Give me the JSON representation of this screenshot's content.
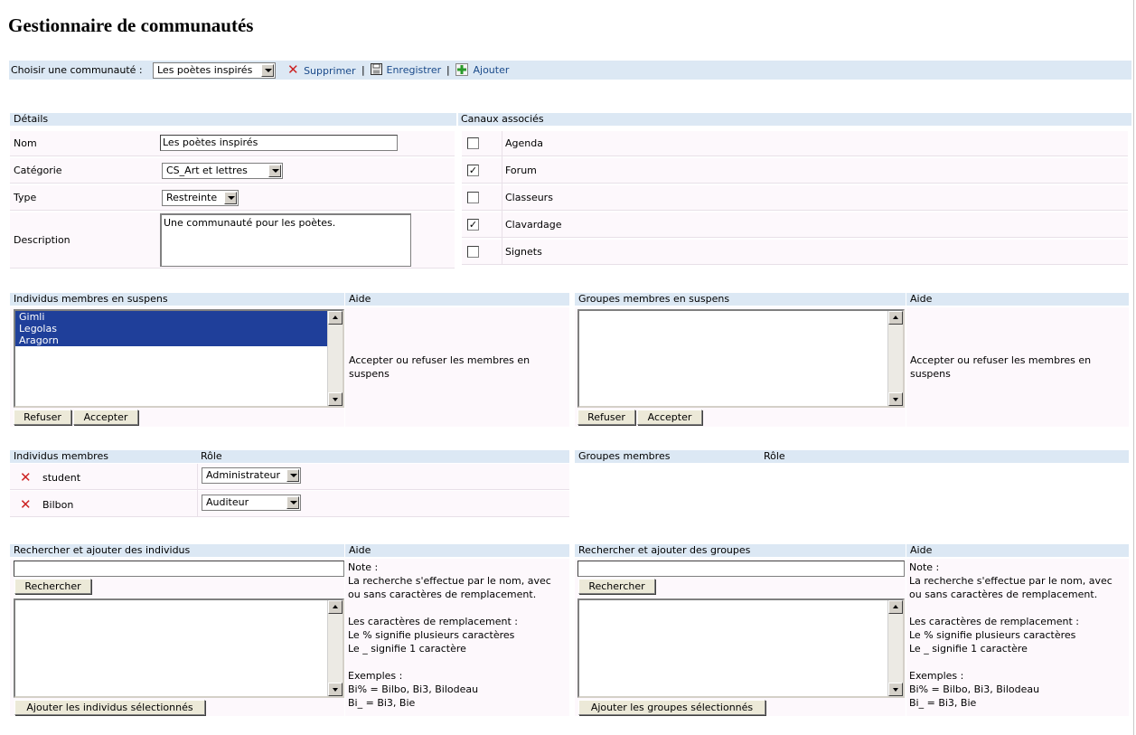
{
  "title": "Gestionnaire de communautés",
  "toolbar": {
    "choose_label": "Choisir une communauté :",
    "selected_community": "Les poètes inspirés",
    "delete_label": "Supprimer",
    "save_label": "Enregistrer",
    "add_label": "Ajouter",
    "separator": "|"
  },
  "details": {
    "header": "Détails",
    "name_label": "Nom",
    "name_value": "Les poètes inspirés",
    "category_label": "Catégorie",
    "category_value": "CS_Art et lettres",
    "type_label": "Type",
    "type_value": "Restreinte",
    "description_label": "Description",
    "description_value": "Une communauté pour les poètes."
  },
  "channels": {
    "header": "Canaux associés",
    "items": [
      {
        "label": "Agenda",
        "checked": false,
        "mark": ""
      },
      {
        "label": "Forum",
        "checked": true,
        "mark": "✓"
      },
      {
        "label": "Classeurs",
        "checked": false,
        "mark": ""
      },
      {
        "label": "Clavardage",
        "checked": true,
        "mark": "✓"
      },
      {
        "label": "Signets",
        "checked": false,
        "mark": ""
      }
    ]
  },
  "pending_individuals": {
    "header": "Individus membres en suspens",
    "items": [
      "Gimli",
      "Legolas",
      "Aragorn"
    ],
    "refuse_label": "Refuser",
    "accept_label": "Accepter",
    "help_header": "Aide",
    "help_text": "Accepter ou refuser les membres en suspens"
  },
  "pending_groups": {
    "header": "Groupes membres en suspens",
    "refuse_label": "Refuser",
    "accept_label": "Accepter",
    "help_header": "Aide",
    "help_text": "Accepter ou refuser les membres en suspens"
  },
  "members": {
    "header": "Individus membres",
    "role_header": "Rôle",
    "rows": [
      {
        "name": "student",
        "role": "Administrateur"
      },
      {
        "name": "Bilbon",
        "role": "Auditeur"
      }
    ]
  },
  "group_members": {
    "header": "Groupes membres",
    "role_header": "Rôle"
  },
  "search_individuals": {
    "header": "Rechercher et ajouter des individus",
    "search_value": "",
    "search_button": "Rechercher",
    "add_button": "Ajouter les individus sélectionnés",
    "help_header": "Aide",
    "help_text": "Note :\nLa recherche s'effectue par le nom, avec ou sans caractères de remplacement.\n\nLes caractères de remplacement :\nLe % signifie plusieurs caractères\nLe _ signifie 1 caractère\n\nExemples :\nBi% = Bilbo, Bi3, Bilodeau\nBi_ = Bi3, Bie"
  },
  "search_groups": {
    "header": "Rechercher et ajouter des groupes",
    "search_value": "",
    "search_button": "Rechercher",
    "add_button": "Ajouter les groupes sélectionnés",
    "help_header": "Aide",
    "help_text": "Note :\nLa recherche s'effectue par le nom, avec ou sans caractères de remplacement.\n\nLes caractères de remplacement :\nLe % signifie plusieurs caractères\nLe _ signifie 1 caractère\n\nExemples :\nBi% = Bilbo, Bi3, Bilodeau\nBi_ = Bi3, Bie"
  },
  "colors": {
    "header_bg": "#dce8f4",
    "cell_bg": "#fdf8fc",
    "link": "#1a4a8a",
    "selection": "#1f3f9a",
    "delete_red": "#cc2222"
  }
}
